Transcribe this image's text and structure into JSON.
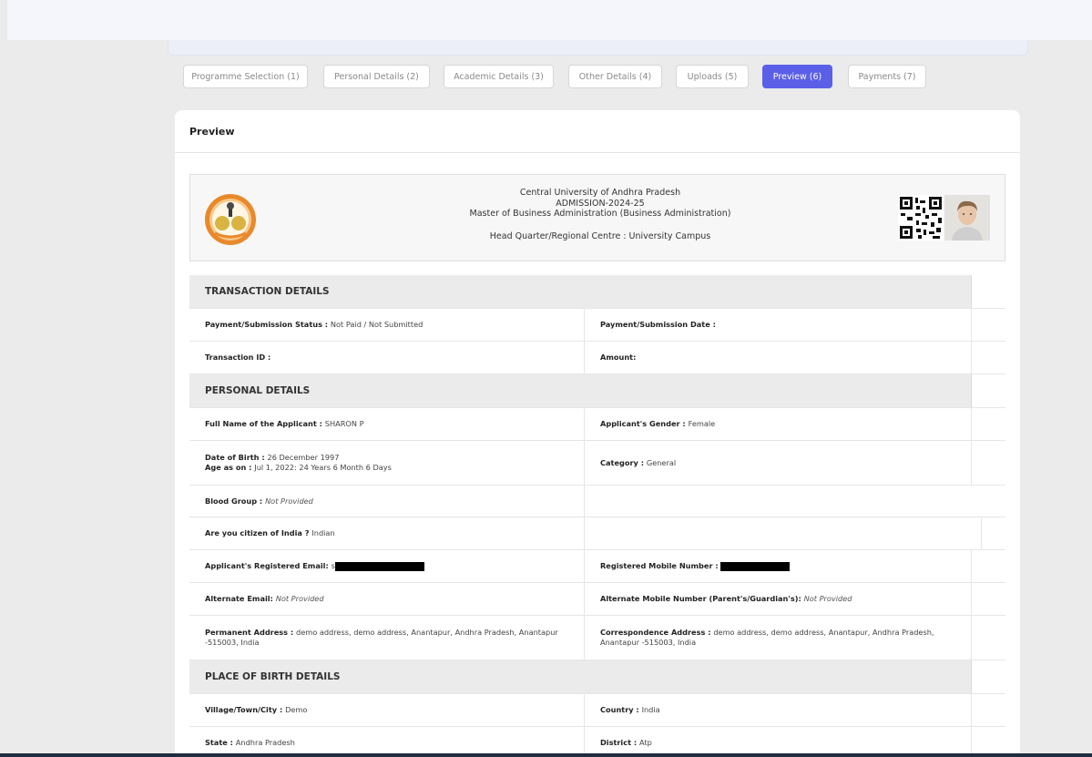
{
  "stepper": {
    "steps": [
      {
        "label": "Programme Selection  (1)"
      },
      {
        "label": "Personal Details  (2)"
      },
      {
        "label": "Academic Details  (3)"
      },
      {
        "label": "Other Details  (4)"
      },
      {
        "label": "Uploads  (5)"
      },
      {
        "label": "Preview  (6)"
      },
      {
        "label": "Payments  (7)"
      }
    ],
    "active_index": 5
  },
  "card": {
    "title": "Preview"
  },
  "header": {
    "university": "Central University of Andhra Pradesh",
    "admission": "ADMISSION-2024-25",
    "programme": "Master of Business Administration (Business Administration)",
    "centre": "Head Quarter/Regional Centre : University Campus"
  },
  "sections": {
    "transaction": {
      "title": "TRANSACTION DETAILS",
      "status_label": "Payment/Submission Status : ",
      "status_value": "Not Paid / Not Submitted",
      "date_label": "Payment/Submission Date :",
      "txn_label": "Transaction ID :",
      "amount_label": "Amount:"
    },
    "personal": {
      "title": "PERSONAL DETAILS",
      "name_label": "Full Name of the Applicant : ",
      "name_value": "SHARON P",
      "gender_label": "Applicant's Gender : ",
      "gender_value": "Female",
      "dob_label": "Date of Birth : ",
      "dob_value": "26 December 1997",
      "age_label": "Age as on : ",
      "age_value": "Jul 1, 2022: 24 Years 6 Month 6 Days",
      "category_label": "Category : ",
      "category_value": "General",
      "blood_label": "Blood Group : ",
      "blood_value": "Not Provided",
      "citizen_label": "Are you citizen of India ? ",
      "citizen_value": "Indian",
      "email_label": "Applicant's Registered Email: ",
      "email_value": "s",
      "mobile_label": "Registered Mobile Number : ",
      "alt_email_label": "Alternate Email: ",
      "alt_email_value": "Not Provided",
      "alt_mobile_label": "Alternate Mobile Number (Parent's/Guardian's): ",
      "alt_mobile_value": "Not Provided",
      "perm_addr_label": "Permanent Address : ",
      "perm_addr_value": "demo address, demo address, Anantapur, Andhra Pradesh, Anantapur -515003, India",
      "corr_addr_label": "Correspondence Address : ",
      "corr_addr_value": "demo address, demo address, Anantapur, Andhra Pradesh, Anantapur -515003, India"
    },
    "birth": {
      "title": "PLACE OF BIRTH DETAILS",
      "village_label": "Village/Town/City : ",
      "village_value": "Demo",
      "country_label": "Country : ",
      "country_value": "India",
      "state_label": "State : ",
      "state_value": "Andhra Pradesh",
      "district_label": "District : ",
      "district_value": "Atp"
    }
  }
}
